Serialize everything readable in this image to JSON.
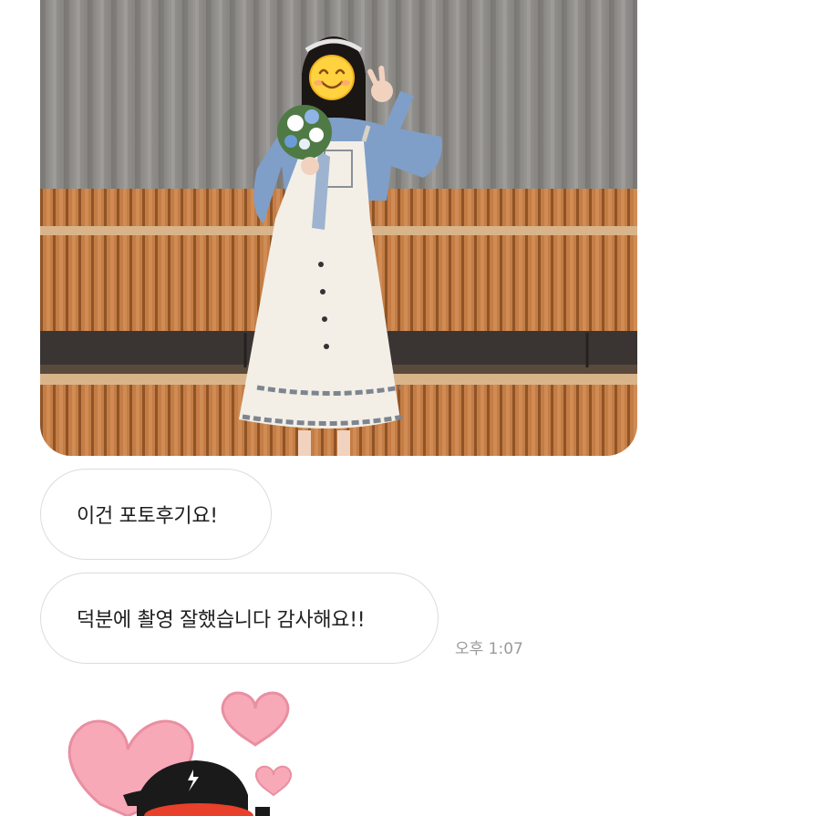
{
  "chat": {
    "photo_message": {
      "type": "image",
      "face_icon": "smiling-face-emoji-icon"
    },
    "messages": [
      {
        "text": "이건 포토후기요!"
      },
      {
        "text": "덕분에 촬영 잘했습니다 감사해요!!"
      }
    ],
    "timestamp": "오후 1:07",
    "sticker": {
      "icon": "heart-character-sticker-icon"
    }
  },
  "colors": {
    "bubble_border": "#dcdcdc",
    "bubble_text": "#1f1f1f",
    "timestamp_text": "#9a9a9a",
    "heart_pink": "#f7a9b8",
    "wood": "#c9824b",
    "curtain": "#8c8a86"
  }
}
